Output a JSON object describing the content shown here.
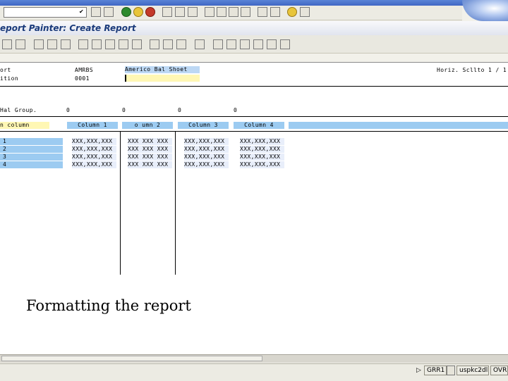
{
  "title": "eport Painter: Create Report",
  "header": {
    "row1_label": "ort",
    "row1_code": "AMRBS",
    "row1_desc": "Americo Bal Shoet",
    "row2_label": "ition",
    "row2_code": "0001",
    "right_text": "Horiz. Scllto 1  / 1"
  },
  "group": {
    "label": "Hal Group.",
    "values": [
      "0",
      "0",
      "0",
      "0"
    ]
  },
  "table": {
    "lead_header": "n column",
    "columns": [
      "Column 1",
      "o umn 2",
      "Column 3",
      "Column 4"
    ],
    "row_labels": [
      "1",
      "2",
      "3",
      "4"
    ],
    "cells": [
      [
        "XXX,XXX,XXX",
        "XXX XXX XXX",
        "XXX,XXX,XXX",
        "XXX,XXX,XXX"
      ],
      [
        "XXX,XXX,XXX",
        "XXX XXX XXX",
        "XXX,XXX,XXX",
        "XXX,XXX,XXX"
      ],
      [
        "XXX,XXX,XXX",
        "XXX XXX XXX",
        "XXX,XXX,XXX",
        "XXX,XXX,XXX"
      ],
      [
        "XXX,XXX,XXX",
        "XXX XXX XXX",
        "XXX,XXX,XXX",
        "XXX,XXX,XXX"
      ]
    ]
  },
  "caption": "Formatting the report",
  "status": {
    "system": "GRR1",
    "server": "uspkc2dl",
    "mode": "OVR"
  },
  "icons": {
    "enter": "check-icon",
    "save": "save-icon"
  }
}
